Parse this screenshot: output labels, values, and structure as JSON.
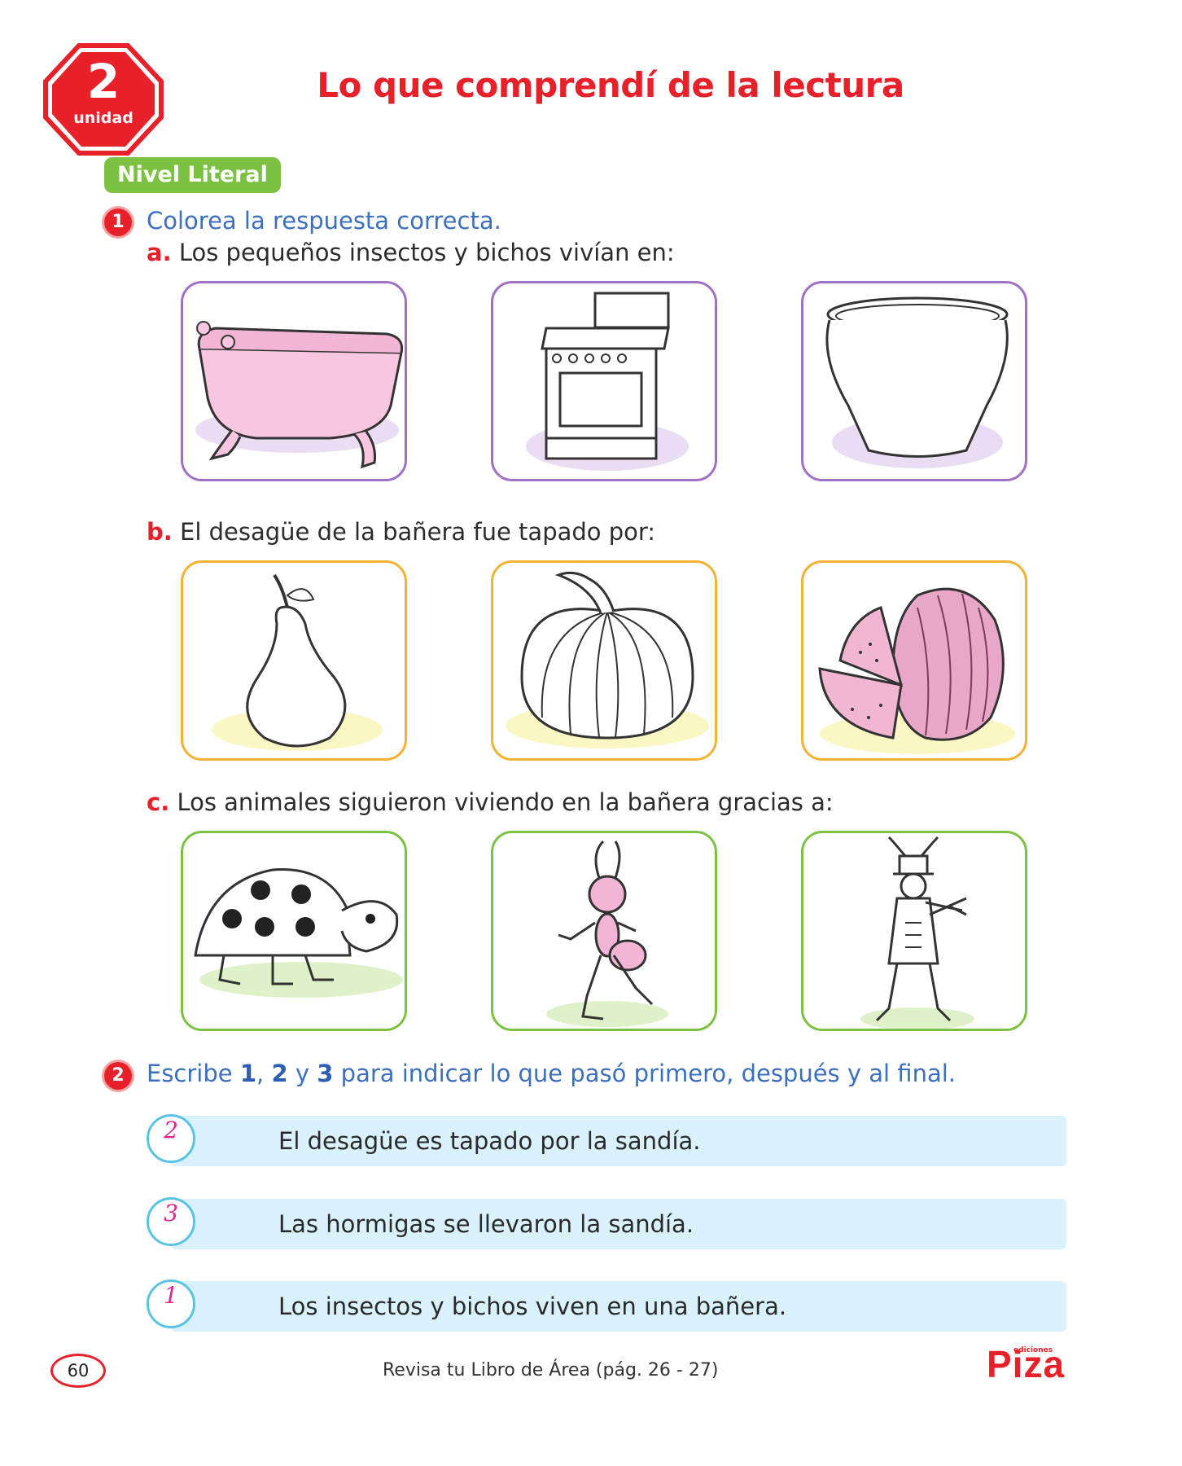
{
  "unit": {
    "number": "2",
    "word": "unidad"
  },
  "title": "Lo que comprendí de la lectura",
  "level": "Nivel Literal",
  "q1": {
    "number": "1",
    "instruction": "Colorea la respuesta correcta.",
    "a": {
      "letter": "a.",
      "text": "Los pequeños insectos y bichos vivían en:",
      "options": [
        "bathtub-picture",
        "stove-picture",
        "pot-picture"
      ]
    },
    "b": {
      "letter": "b.",
      "text": "El desagüe de la bañera fue tapado por:",
      "options": [
        "pear-picture",
        "pumpkin-picture",
        "watermelon-picture"
      ]
    },
    "c": {
      "letter": "c.",
      "text": "Los animales siguieron viviendo en la bañera gracias a:",
      "options": [
        "ladybug-picture",
        "ant-picture",
        "cricket-violinist-picture"
      ]
    }
  },
  "q2": {
    "number": "2",
    "instruction_pre": "Escribe ",
    "n1": "1",
    "sep1": ", ",
    "n2": "2",
    "sep2": " y ",
    "n3": "3",
    "instruction_post": " para indicar lo que pasó primero, después y al final.",
    "items": [
      {
        "answer": "2",
        "text": "El desagüe es tapado por la sandía."
      },
      {
        "answer": "3",
        "text": "Las hormigas se llevaron la sandía."
      },
      {
        "answer": "1",
        "text": "Los insectos y bichos viven en una bañera."
      }
    ]
  },
  "footer": {
    "page_number": "60",
    "reference": "Revisa tu Libro de Área (pág. 26 - 27)",
    "logo_small": "ediciones",
    "logo": "Piza"
  },
  "colors": {
    "accent_red": "#e8202a",
    "instruction_blue": "#3b6fc0",
    "level_green": "#7cc242",
    "answer_pink": "#e2248c",
    "bar_blue": "#d8f1fb"
  }
}
